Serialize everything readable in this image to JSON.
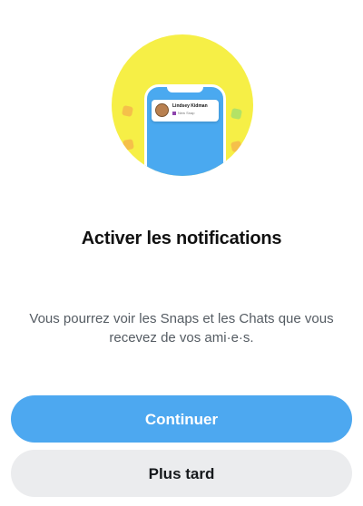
{
  "illustration": {
    "notification": {
      "name": "Lindsey Kidman",
      "subtitle": "New Snap"
    },
    "circle_color": "#f6ef46",
    "phone_color": "#4aa9f0"
  },
  "title": "Activer les notifications",
  "description": "Vous pourrez voir les Snaps et les Chats que vous recevez de vos ami·e·s.",
  "buttons": {
    "continue_label": "Continuer",
    "later_label": "Plus tard"
  },
  "colors": {
    "primary": "#4da8f0",
    "secondary": "#ebecee",
    "text": "#111111"
  }
}
